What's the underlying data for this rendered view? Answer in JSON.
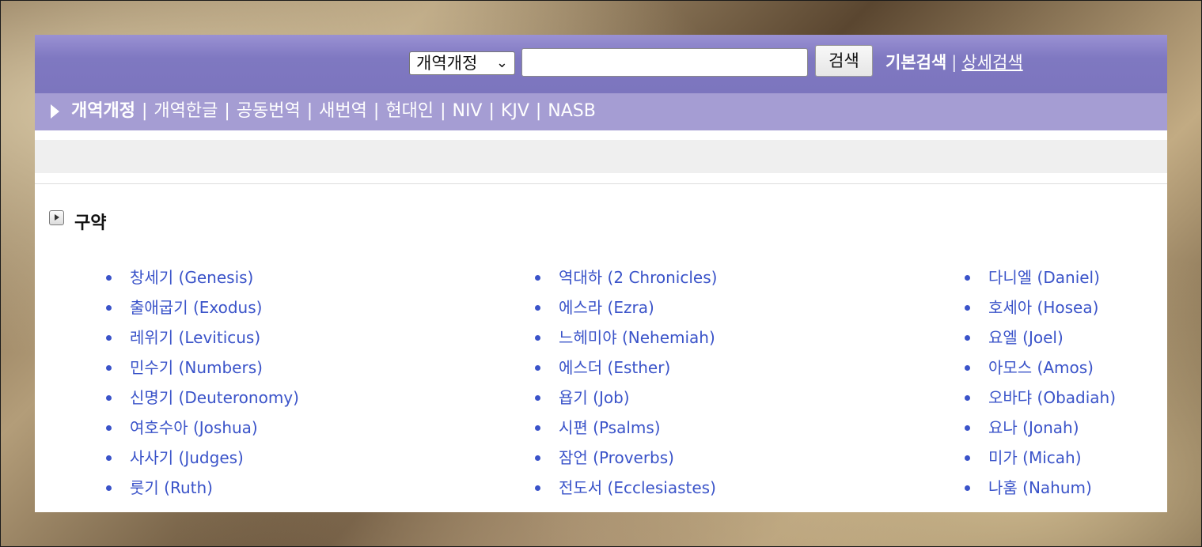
{
  "search": {
    "version_selected": "개역개정",
    "input_value": "",
    "button_label": "검색",
    "mode_basic": "기본검색",
    "mode_separator": "|",
    "mode_advanced": "상세검색"
  },
  "versions": [
    {
      "label": "개역개정",
      "active": true
    },
    {
      "label": "개역한글"
    },
    {
      "label": "공동번역"
    },
    {
      "label": "새번역"
    },
    {
      "label": "현대인"
    },
    {
      "label": "NIV"
    },
    {
      "label": "KJV"
    },
    {
      "label": "NASB"
    }
  ],
  "version_separator": "|",
  "section": {
    "title": "구약"
  },
  "books": {
    "col1": [
      "창세기 (Genesis)",
      "출애굽기 (Exodus)",
      "레위기 (Leviticus)",
      "민수기 (Numbers)",
      "신명기 (Deuteronomy)",
      "여호수아 (Joshua)",
      "사사기 (Judges)",
      "룻기 (Ruth)"
    ],
    "col2": [
      "역대하 (2 Chronicles)",
      "에스라 (Ezra)",
      "느헤미야 (Nehemiah)",
      "에스더 (Esther)",
      "욥기 (Job)",
      "시편 (Psalms)",
      "잠언 (Proverbs)",
      "전도서 (Ecclesiastes)"
    ],
    "col3": [
      "다니엘 (Daniel)",
      "호세아 (Hosea)",
      "요엘 (Joel)",
      "아모스 (Amos)",
      "오바댜 (Obadiah)",
      "요나 (Jonah)",
      "미가 (Micah)",
      "나훔 (Nahum)"
    ]
  },
  "colors": {
    "link": "#3a53c9",
    "topbar": "#7f78c1",
    "versionbar": "#a59dd3"
  }
}
